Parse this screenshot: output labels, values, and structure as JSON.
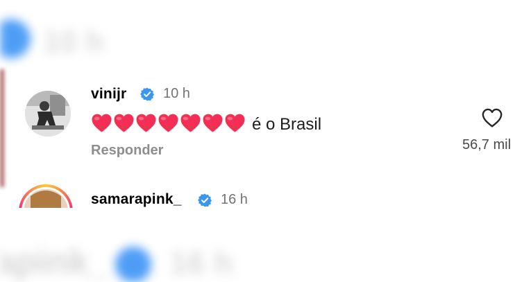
{
  "background_top": {
    "time": "10 h"
  },
  "background_bottom": {
    "username": "apink_",
    "time": "16 h"
  },
  "comments": [
    {
      "username": "vinijr",
      "verified": true,
      "time": "10 h",
      "emoji_count": 7,
      "text": "é o Brasil",
      "reply_label": "Responder",
      "like_count": "56,7 mil"
    },
    {
      "username": "samarapink_",
      "verified": true,
      "time": "16 h"
    }
  ],
  "icons": {
    "verified": "verified-badge-icon",
    "like": "heart-outline-icon",
    "emoji": "red-heart-emoji"
  },
  "colors": {
    "verified_blue": "#3897f0",
    "heart_red": "#f42f54",
    "secondary_text": "#737373"
  }
}
